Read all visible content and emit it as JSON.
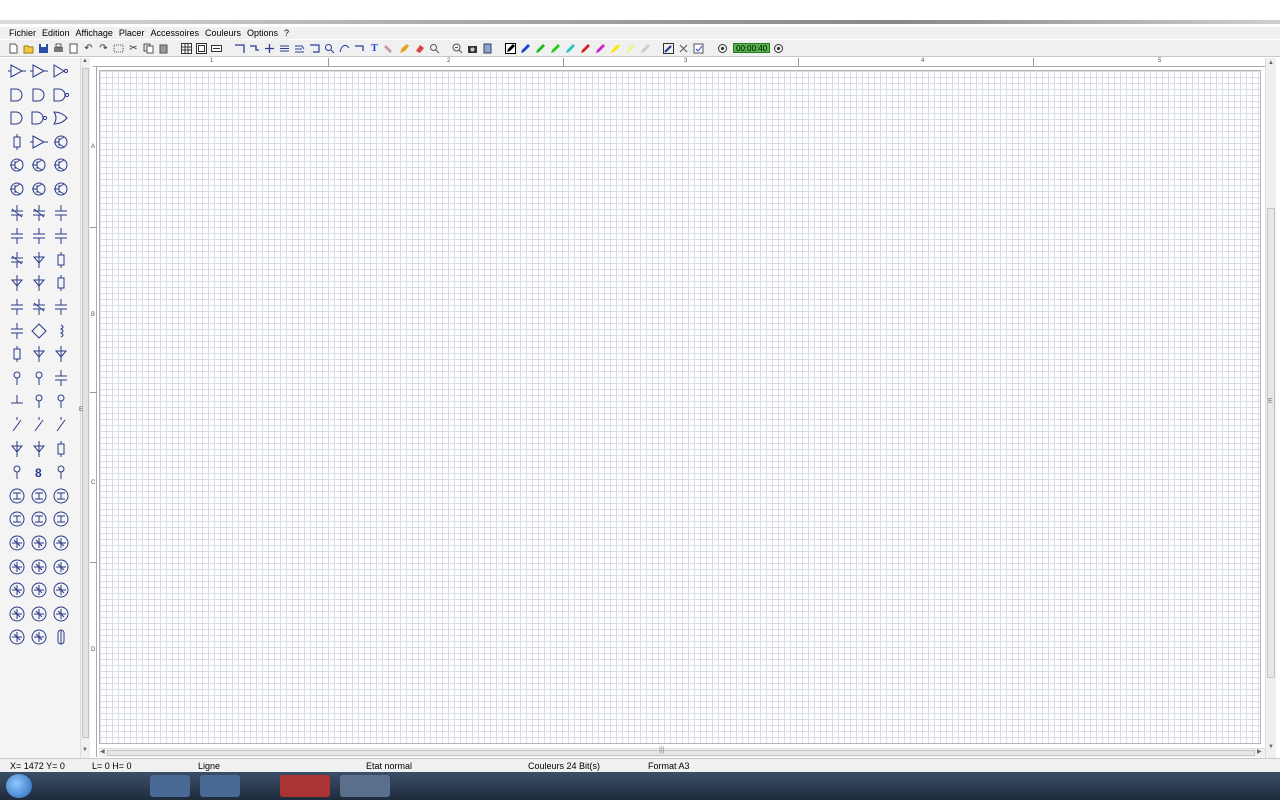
{
  "menu": {
    "items": [
      "Fichier",
      "Edition",
      "Affichage",
      "Placer",
      "Accessoires",
      "Couleurs",
      "Options",
      "?"
    ]
  },
  "toolbar": {
    "timer": "00:00:40",
    "pen_colors": [
      "#000000",
      "#1a3fd1",
      "#1fb81f",
      "#1fd11f",
      "#23c4c4",
      "#e01f1f",
      "#d01fd0",
      "#ffe600",
      "#f2f28a",
      "#cccccc"
    ]
  },
  "ruler_top": {
    "labels": [
      "1",
      "2",
      "3",
      "4",
      "5"
    ]
  },
  "ruler_left": {
    "labels": [
      "A",
      "B",
      "C",
      "D"
    ]
  },
  "status": {
    "coords": "X= 1472  Y= 0",
    "dims": "L= 0  H= 0",
    "tool": "Ligne",
    "state": "Etat normal",
    "colors": "Couleurs 24 Bit(s)",
    "format": "Format A3"
  },
  "side_markers": {
    "e_left": "E",
    "e_right": "E"
  }
}
